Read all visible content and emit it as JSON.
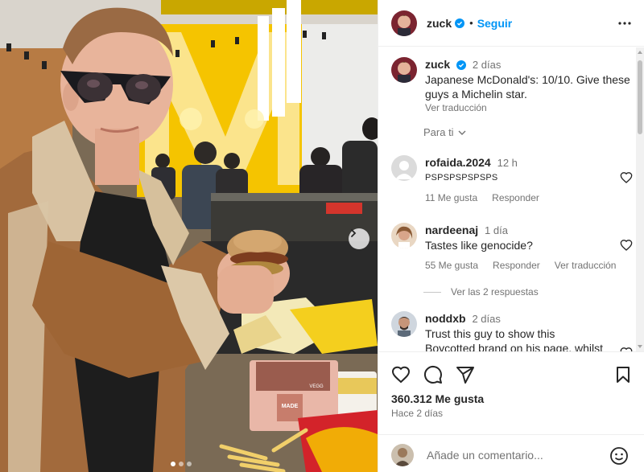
{
  "post": {
    "author": "zuck",
    "follow_label": "Seguir",
    "caption_time": "2 días",
    "caption_text_1": "Japanese McDonald's: 10/10. Give these",
    "caption_text_2": "guys a Michelin star.",
    "translate_label": "Ver traducción",
    "filter_label": "Para ti",
    "likes": "360.312 Me gusta",
    "posted_ago": "Hace 2 días"
  },
  "comments": [
    {
      "user": "rofaida.2024",
      "time": "12 h",
      "text": "PSPSPSPSPSPS",
      "likes": "11 Me gusta",
      "reply": "Responder"
    },
    {
      "user": "nardeenaj",
      "time": "1 día",
      "text": "Tastes like genocide?",
      "likes": "55 Me gusta",
      "reply": "Responder",
      "translate": "Ver traducción"
    },
    {
      "user": "noddxb",
      "time": "2 días",
      "text_1": "Trust this guy to show this",
      "text_2": "Boycotted brand on his page, whilst"
    }
  ],
  "replies_label": "Ver las 2 respuestas",
  "add_comment": {
    "placeholder": "Añade un comentario..."
  },
  "photo_text": {
    "box_brand": "MADE",
    "box_sub": "VEGG"
  },
  "colors": {
    "accent": "#0095f6",
    "verified": "#0095f6",
    "muted": "#737373",
    "wall_yellow": "#f5c400"
  },
  "icons": [
    "verified-badge",
    "more-icon",
    "chevron-down-icon",
    "heart-icon",
    "comment-icon",
    "share-icon",
    "save-icon",
    "emoji-icon",
    "next-arrow-icon"
  ]
}
